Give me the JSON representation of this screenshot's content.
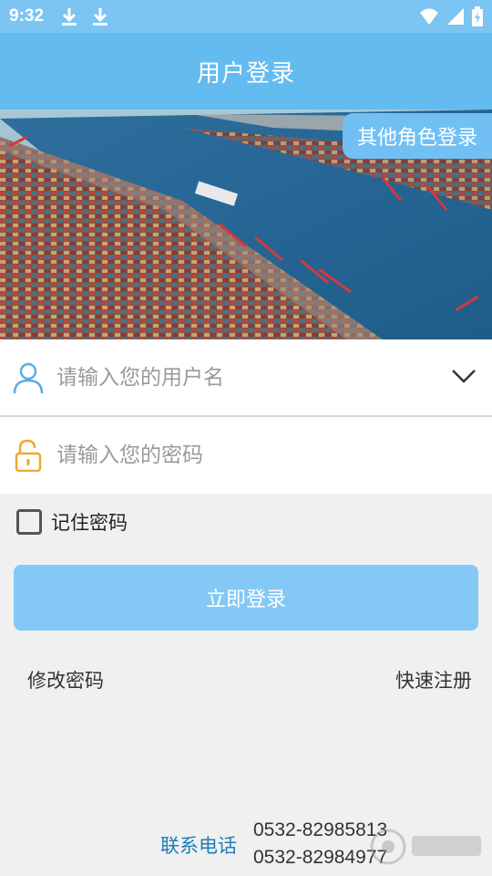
{
  "status_bar": {
    "time": "9:32",
    "icons": [
      "download-icon",
      "download-icon",
      "wifi-icon",
      "signal-icon",
      "battery-icon"
    ]
  },
  "app_bar": {
    "title": "用户登录"
  },
  "banner": {
    "other_role_login": "其他角色登录",
    "image_desc": "container-port-aerial-photo"
  },
  "form": {
    "username_placeholder": "请输入您的用户名",
    "password_placeholder": "请输入您的密码",
    "remember_label": "记住密码",
    "remember_checked": false,
    "login_button": "立即登录"
  },
  "links": {
    "change_password": "修改密码",
    "quick_register": "快速注册"
  },
  "contact": {
    "label": "联系电话",
    "phone1": "0532-82985813",
    "phone2": "0532-82984977"
  },
  "colors": {
    "status_bar": "#7cc4f2",
    "app_bar": "#64bbf0",
    "button": "#84c9f5",
    "contact_label": "#1a7fb8",
    "user_icon": "#5aaee0",
    "lock_icon": "#f0a830"
  }
}
